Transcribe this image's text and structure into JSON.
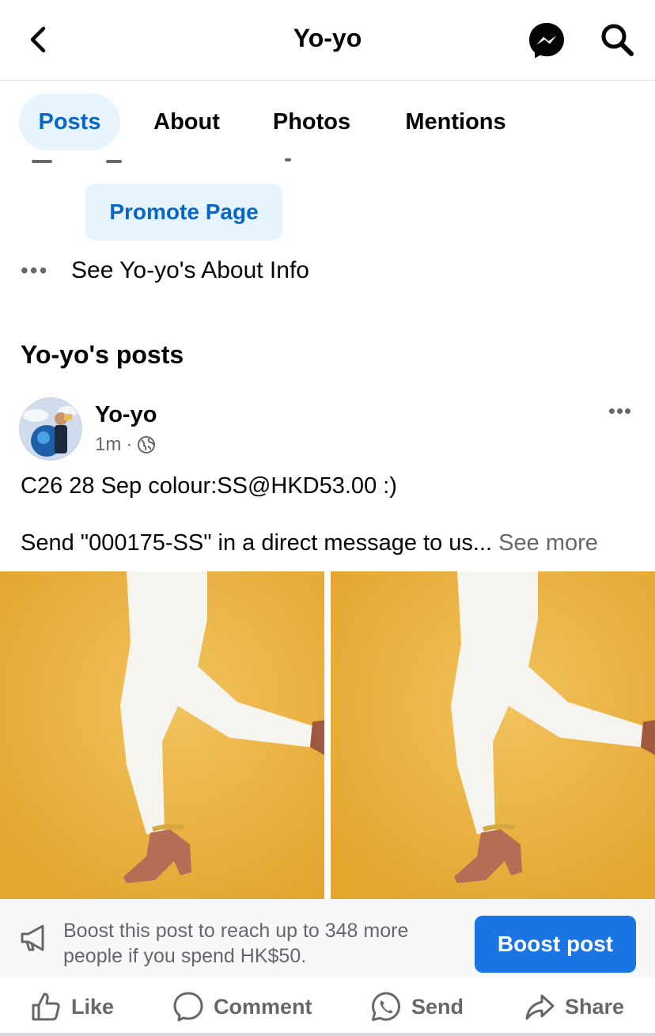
{
  "header": {
    "title": "Yo-yo"
  },
  "tabs": [
    {
      "label": "Posts",
      "active": true
    },
    {
      "label": "About",
      "active": false
    },
    {
      "label": "Photos",
      "active": false
    },
    {
      "label": "Mentions",
      "active": false
    }
  ],
  "intro": {
    "promote_label": "Promote Page",
    "about_info_label": "See Yo-yo's About Info"
  },
  "posts_section": {
    "title": "Yo-yo's posts"
  },
  "post": {
    "author": "Yo-yo",
    "time": "1m",
    "separator": "·",
    "audience_icon": "globe-icon",
    "line1": "C26 28 Sep colour:SS@HKD53.00 :)",
    "line2": "Send \"000175-SS\" in a direct message to us...",
    "see_more": "See more",
    "photo_background_color": "#e9ae36"
  },
  "boost": {
    "text": "Boost this post to reach up to 348 more people if you spend HK$50.",
    "button_label": "Boost post"
  },
  "actions": {
    "like": "Like",
    "comment": "Comment",
    "send": "Send",
    "share": "Share"
  },
  "colors": {
    "accent": "#1b74e4",
    "accent_text": "#0866c6",
    "accent_bg": "#e7f3ff",
    "muted": "#65676b"
  }
}
